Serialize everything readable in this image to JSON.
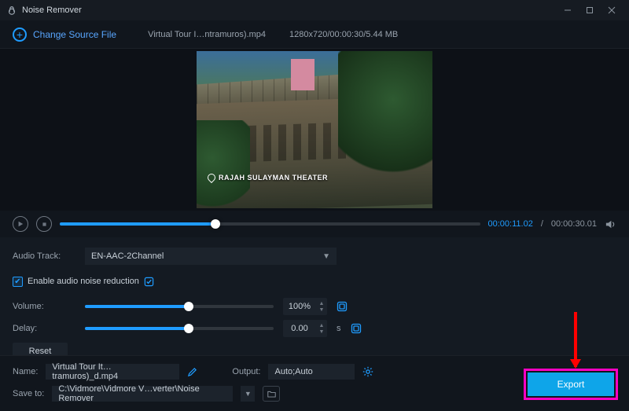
{
  "titlebar": {
    "app_title": "Noise Remover"
  },
  "toolbar": {
    "change_source_label": "Change Source File",
    "source_filename": "Virtual Tour I…ntramuros).mp4",
    "source_meta": "1280x720/00:00:30/5.44 MB"
  },
  "video": {
    "caption_text": "RAJAH SULAYMAN THEATER"
  },
  "playback": {
    "progress_pct": 37,
    "current_time": "00:00:11.02",
    "total_time": "00:00:30.01"
  },
  "controls": {
    "audio_track_label": "Audio Track:",
    "audio_track_value": "EN-AAC-2Channel",
    "noise_reduction_label": "Enable audio noise reduction",
    "noise_reduction_checked": true,
    "volume_label": "Volume:",
    "volume_pct": 100,
    "volume_display": "100%",
    "delay_label": "Delay:",
    "delay_pct": 50,
    "delay_display": "0.00",
    "delay_unit": "s",
    "reset_label": "Reset"
  },
  "output": {
    "name_label": "Name:",
    "name_value": "Virtual Tour It…tramuros)_d.mp4",
    "output_label": "Output:",
    "output_value": "Auto;Auto",
    "saveto_label": "Save to:",
    "saveto_value": "C:\\Vidmore\\Vidmore V…verter\\Noise Remover",
    "export_label": "Export"
  },
  "colors": {
    "accent": "#1f9cff",
    "export_bg": "#0ea5e9",
    "highlight": "#ff00c3",
    "annotation": "#ff0000"
  }
}
